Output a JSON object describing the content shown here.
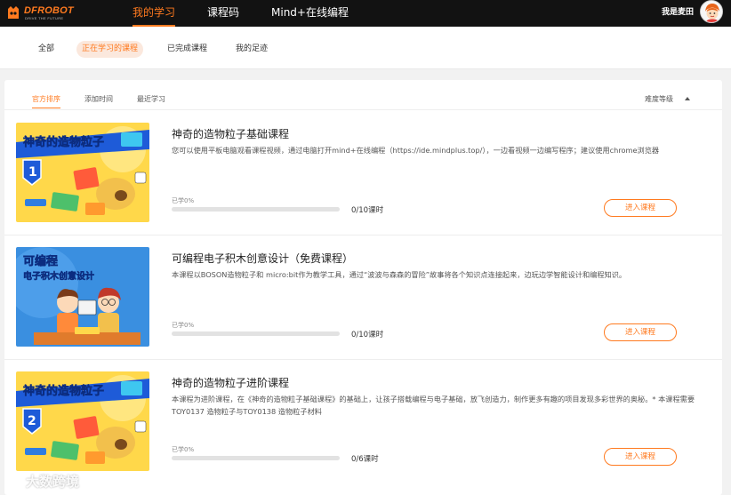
{
  "header": {
    "logo_text": "DFROBOT",
    "logo_tagline": "DRIVE THE FUTURE",
    "nav": [
      "我的学习",
      "课程码",
      "Mind+在线编程"
    ],
    "user_name": "我是麦田"
  },
  "subnav": {
    "items": [
      "全部",
      "正在学习的课程",
      "已完成课程",
      "我的足迹"
    ]
  },
  "sortbar": {
    "items": [
      "官方排序",
      "添加时间",
      "最近学习"
    ],
    "difficulty": "难度等级"
  },
  "thumbnails": {
    "c1_title": "神奇的造物粒子",
    "c1_number": "1",
    "c2_title_1": "可编程",
    "c2_title_2": "电子积木创意设计",
    "c3_title": "神奇的造物粒子",
    "c3_number": "2"
  },
  "courses": [
    {
      "title": "神奇的造物粒子基础课程",
      "description": "您可以使用平板电脑观看课程视频，通过电脑打开mind+在线编程（https://ide.mindplus.top/），一边看视频一边编写程序；建议使用chrome浏览器",
      "learned": "已学0%",
      "progress": 0,
      "lessons": "0/10课时",
      "button": "进入课程"
    },
    {
      "title": "可编程电子积木创意设计（免费课程）",
      "description": "本课程以BOSON造物粒子和 micro:bit作为教学工具，通过“波波与森森的冒险”故事将各个知识点连接起来，边玩边学智能设计和编程知识。",
      "learned": "已学0%",
      "progress": 0,
      "lessons": "0/10课时",
      "button": "进入课程"
    },
    {
      "title": "神奇的造物粒子进阶课程",
      "description": "本课程为进阶课程，在《神奇的造物粒子基础课程》的基础上，让孩子搭载编程与电子基础，放飞创造力，制作更多有趣的项目发现多彩世界的奥秘。* 本课程需要TOY0137 造物粒子与TOY0138 造物粒子材料",
      "learned": "已学0%",
      "progress": 0,
      "lessons": "0/6课时",
      "button": "进入课程"
    }
  ],
  "watermark": "大数跨境",
  "colors": {
    "accent": "#ff7a1f",
    "topbar": "#121212",
    "background": "#f2f2f2"
  }
}
